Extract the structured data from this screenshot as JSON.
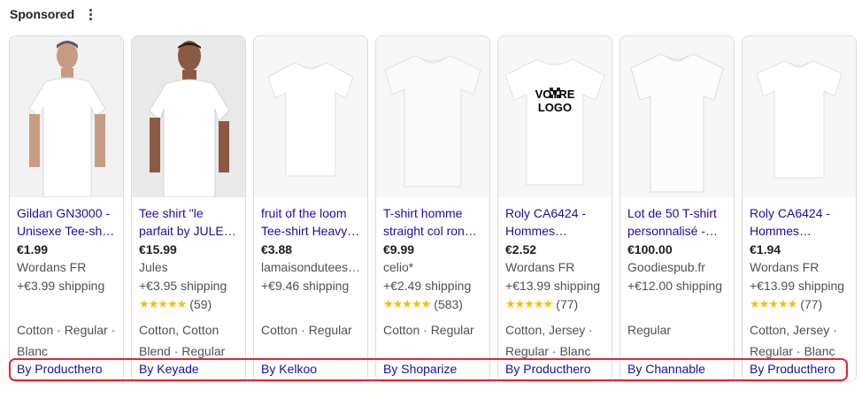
{
  "header": {
    "label": "Sponsored",
    "menu_icon": "more-vert-icon"
  },
  "colors": {
    "title_link": "#1a0dab",
    "star": "#fbbc04",
    "highlight": "#e8262b"
  },
  "products": [
    {
      "title_line1": "Gildan GN3000 -",
      "title_line2": "Unisexe Tee-sh…",
      "price": "€1.99",
      "merchant": "Wordans FR",
      "shipping": "+€3.99 shipping",
      "rating_count": "",
      "attr_line1": "Cotton · Regular ·",
      "attr_line2": "Blanc",
      "byline": "By Producthero"
    },
    {
      "title_line1": "Tee shirt \"le",
      "title_line2": "parfait by JULE…",
      "price": "€15.99",
      "merchant": "Jules",
      "shipping": "+€3.95 shipping",
      "rating_count": "(59)",
      "attr_line1": "Cotton, Cotton",
      "attr_line2": "Blend · Regular",
      "byline": "By Keyade"
    },
    {
      "title_line1": "fruit of the loom",
      "title_line2": "Tee-shirt Heavy…",
      "price": "€3.88",
      "merchant": "lamaisondutees…",
      "shipping": "+€9.46 shipping",
      "rating_count": "",
      "attr_line1": "Cotton · Regular",
      "attr_line2": "",
      "byline": "By Kelkoo"
    },
    {
      "title_line1": "T-shirt homme",
      "title_line2": "straight col ron…",
      "price": "€9.99",
      "merchant": "celio*",
      "shipping": "+€2.49 shipping",
      "rating_count": "(583)",
      "attr_line1": "Cotton · Regular",
      "attr_line2": "",
      "byline": "By Shoparize"
    },
    {
      "title_line1": "Roly CA6424 -",
      "title_line2": "Hommes…",
      "price": "€2.52",
      "merchant": "Wordans FR",
      "shipping": "+€13.99 shipping",
      "rating_count": "(77)",
      "attr_line1": "Cotton, Jersey ·",
      "attr_line2": "Regular · Blanc",
      "byline": "By Producthero",
      "print_text": "VOTRE LOGO"
    },
    {
      "title_line1": "Lot de 50 T-shirt",
      "title_line2": "personnalisé -…",
      "price": "€100.00",
      "merchant": "Goodiespub.fr",
      "shipping": "+€12.00 shipping",
      "rating_count": "",
      "attr_line1": "Regular",
      "attr_line2": "",
      "byline": "By Channable"
    },
    {
      "title_line1": "Roly CA6424 -",
      "title_line2": "Hommes…",
      "price": "€1.94",
      "merchant": "Wordans FR",
      "shipping": "+€13.99 shipping",
      "rating_count": "(77)",
      "attr_line1": "Cotton, Jersey ·",
      "attr_line2": "Regular · Blanc",
      "byline": "By Producthero"
    }
  ]
}
